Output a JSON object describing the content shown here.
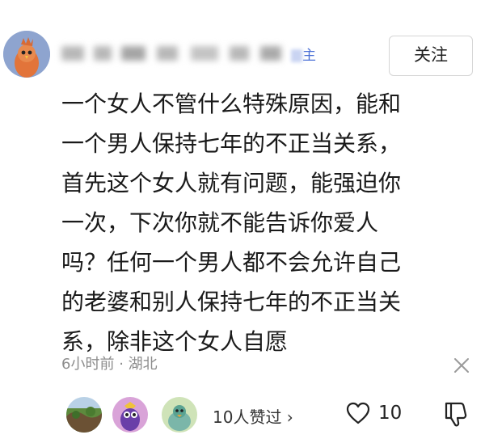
{
  "user": {
    "tag": "主"
  },
  "follow_label": "关注",
  "comment": {
    "lines": [
      "一个女人不管什么特殊原因，能和",
      "一个男人保持七年的不正当关系，",
      "首先这个女人就有问题，能强迫你",
      "一次，下次你就不能告诉你爱人",
      "吗？任何一个男人都不会允许自己",
      "的老婆和别人保持七年的不正当关",
      "系，除非这个女人自愿"
    ]
  },
  "meta": {
    "time": "6小时前",
    "separator": "·",
    "location": "湖北"
  },
  "likes": {
    "summary": "10人赞过 ›",
    "count": "10"
  },
  "colors": {
    "tag_blue": "#4a6fd6",
    "meta_gray": "#8c8c8c"
  },
  "icons": [
    "bird-avatar-icon",
    "close-icon",
    "heart-icon",
    "thumbs-down-icon"
  ]
}
